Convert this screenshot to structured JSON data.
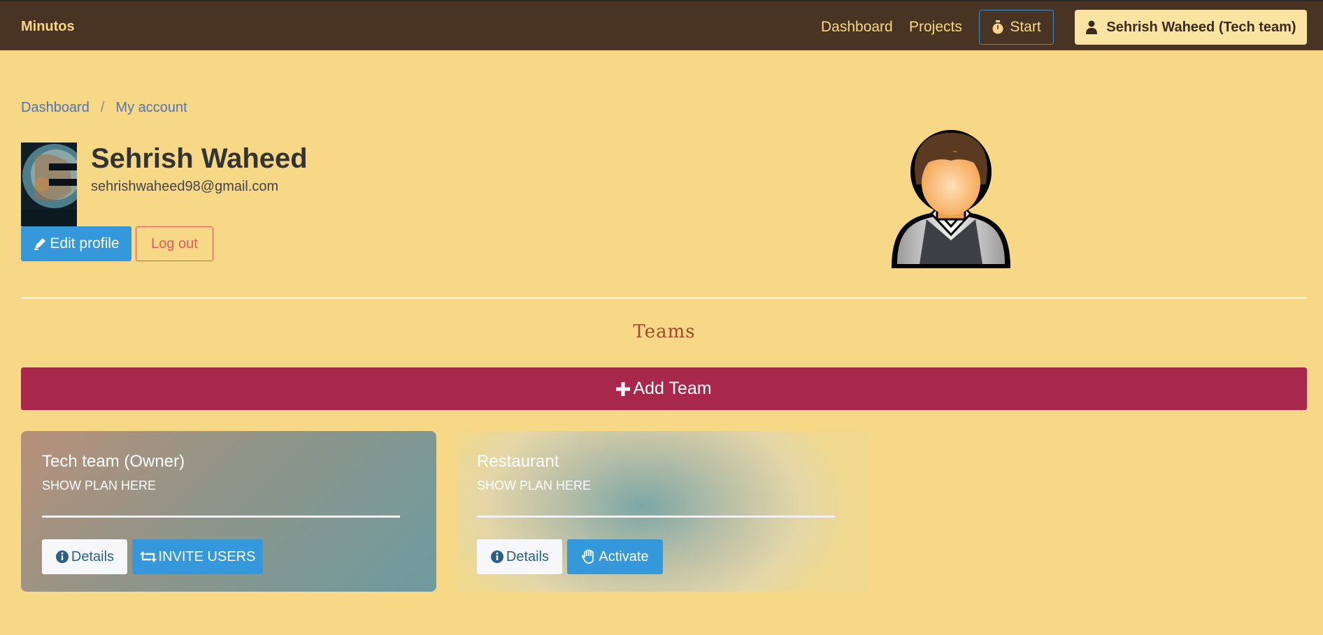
{
  "navbar": {
    "brand": "Minutos",
    "links": [
      "Dashboard",
      "Projects"
    ],
    "start_label": "Start",
    "user_label": "Sehrish Waheed (Tech team)"
  },
  "breadcrumb": [
    "Dashboard",
    "My account"
  ],
  "profile": {
    "name": "Sehrish Waheed",
    "email": "sehrishwaheed98@gmail.com",
    "edit_label": "Edit profile",
    "logout_label": "Log out"
  },
  "teams": {
    "title": "Teams",
    "add_label": "Add Team",
    "cards": [
      {
        "name": "Tech team (Owner)",
        "plan": "SHOW PLAN HERE",
        "details_label": "Details",
        "action_label": "INVITE USERS"
      },
      {
        "name": "Restaurant",
        "plan": "SHOW PLAN HERE",
        "details_label": "Details",
        "action_label": "Activate"
      }
    ]
  },
  "icons": {
    "start": "stopwatch-icon",
    "user": "user-icon",
    "edit": "pen-icon",
    "add": "plus-icon",
    "details": "info-circle-icon",
    "invite": "retweet-icon",
    "activate": "hand-icon"
  },
  "colors": {
    "background": "#f7d886",
    "navbar": "#493322",
    "primary": "#3498db",
    "add_team": "#a8284c",
    "logout": "#e05a5a"
  }
}
